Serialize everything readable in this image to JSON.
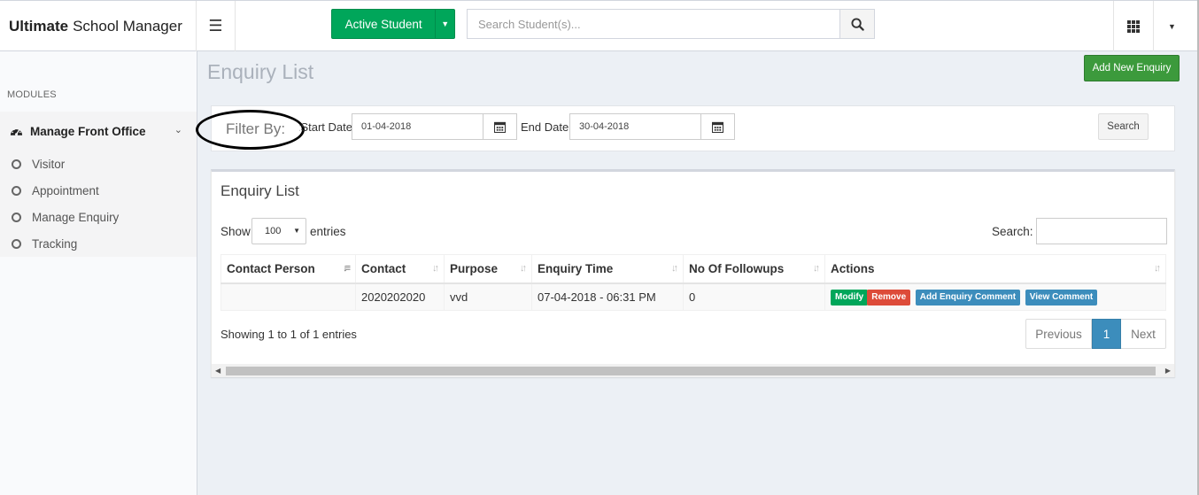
{
  "brand": {
    "bold": "Ultimate",
    "rest": "School Manager"
  },
  "topbar": {
    "active_student_label": "Active Student",
    "search_placeholder": "Search Student(s)..."
  },
  "sidebar": {
    "modules_header": "MODULES",
    "parent_label": "Manage Front Office",
    "items": [
      {
        "label": "Visitor"
      },
      {
        "label": "Appointment"
      },
      {
        "label": "Manage Enquiry"
      },
      {
        "label": "Tracking"
      }
    ]
  },
  "page": {
    "title": "Enquiry List",
    "add_button": "Add New Enquiry"
  },
  "filter": {
    "label": "Filter By:",
    "start_label": "Start Date:",
    "start_value": "01-04-2018",
    "end_label": "End Date:",
    "end_value": "30-04-2018",
    "search_button": "Search"
  },
  "list": {
    "title": "Enquiry List",
    "show_label": "Show",
    "entries_value": "100",
    "entries_label": "entries",
    "search_label": "Search:",
    "columns": [
      "Contact Person",
      "Contact",
      "Purpose",
      "Enquiry Time",
      "No Of Followups",
      "Actions"
    ],
    "rows": [
      {
        "contact_person": "",
        "contact": "2020202020",
        "purpose": "vvd",
        "enquiry_time": "07-04-2018 - 06:31 PM",
        "followups": "0"
      }
    ],
    "actions": {
      "modify": "Modify",
      "remove": "Remove",
      "add_comment": "Add Enquiry Comment",
      "view_comment": "View Comment"
    },
    "info": "Showing 1 to 1 of 1 entries",
    "pager": {
      "previous": "Previous",
      "current": "1",
      "next": "Next"
    }
  },
  "colors": {
    "green": "#00a65a",
    "red": "#dd4b39",
    "blue": "#3c8dbc",
    "add_button": "#3c9a3c"
  }
}
